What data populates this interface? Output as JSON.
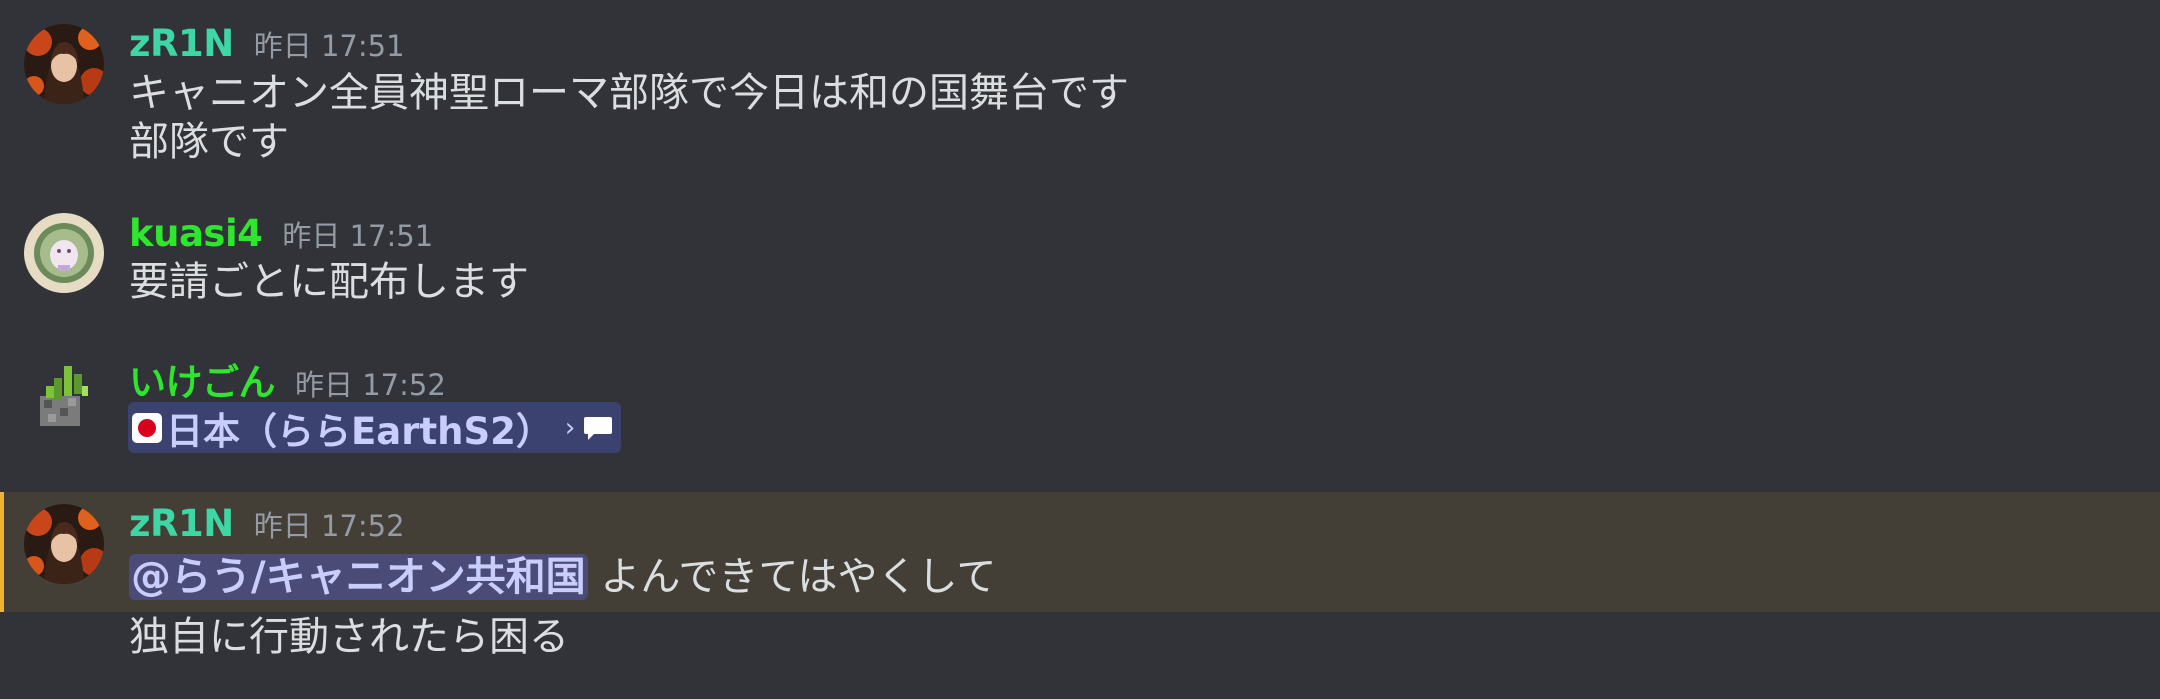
{
  "messages": [
    {
      "username": "zR1N",
      "username_color": "#3fd6a6",
      "timestamp": "昨日 17:51",
      "avatar": "anime-portrait-avatar",
      "lines": [
        "キャニオン全員神聖ローマ部隊で今日は和の国舞台です",
        "部隊です"
      ]
    },
    {
      "username": "kuasi4",
      "username_color": "#2ee62e",
      "timestamp": "昨日 17:51",
      "avatar": "round-badge-avatar",
      "lines": [
        "要請ごとに配布します"
      ]
    },
    {
      "username": "いけごん",
      "username_color": "#2ee62e",
      "timestamp": "昨日 17:52",
      "avatar": "pixel-plant-avatar",
      "channel_link": {
        "flag_icon": "japan-flag-icon",
        "name": "日本（ららEarthS2）",
        "arrow": "›",
        "bubble_icon": "chat-bubble-icon"
      }
    },
    {
      "username": "zR1N",
      "username_color": "#3fd6a6",
      "timestamp": "昨日 17:52",
      "avatar": "anime-portrait-avatar",
      "highlighted": true,
      "mention": "@らう/キャニオン共和国",
      "mention_suffix": " よんできてはやくして",
      "lines": [
        "独自に行動されたら困る"
      ]
    }
  ]
}
